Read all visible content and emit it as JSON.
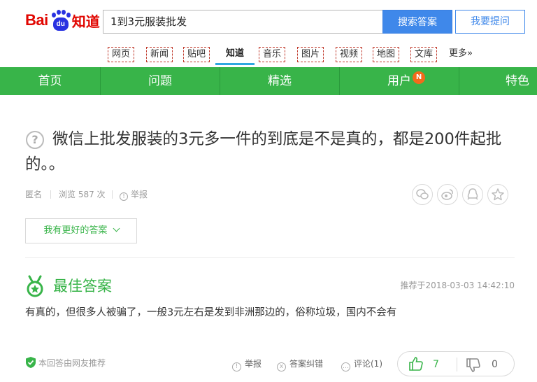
{
  "logo": {
    "bai": "Bai",
    "du": "du",
    "zhidao": "知道"
  },
  "search": {
    "query": "1到3元服装批发",
    "submit_label": "搜索答案",
    "ask_label": "我要提问"
  },
  "subnav": {
    "items": [
      "网页",
      "新闻",
      "贴吧",
      "知道",
      "音乐",
      "图片",
      "视频",
      "地图",
      "文库",
      "更多»"
    ],
    "active": "知道"
  },
  "mainnav": {
    "items": [
      "首页",
      "问题",
      "精选",
      "用户",
      "特色"
    ],
    "badge": "N"
  },
  "question": {
    "title": "微信上批发服装的3元多一件的到底是不是真的，都是200件起批的。。",
    "icon": "?",
    "author": "匿名",
    "views": "浏览 587 次",
    "report_label": "举报",
    "share_icons": [
      "wechat-icon",
      "weibo-icon",
      "qq-icon",
      "star-icon"
    ]
  },
  "better_answer_label": "我有更好的答案",
  "best_answer": {
    "heading": "最佳答案",
    "recommended_at": "推荐于2018-03-03 14:42:10",
    "text": "有真的，但很多人被骗了，一般3元左右是发到非洲那边的，俗称垃圾，国内不会有",
    "source_note": "本回答由网友推荐",
    "report_label": "举报",
    "correct_label": "答案纠错",
    "comment_label": "评论(1)",
    "upvotes": "7",
    "downvotes": "0"
  },
  "colors": {
    "brand_red": "#e10601",
    "brand_blue": "#2932e1",
    "green": "#38b449",
    "search_blue": "#3f88ea"
  }
}
